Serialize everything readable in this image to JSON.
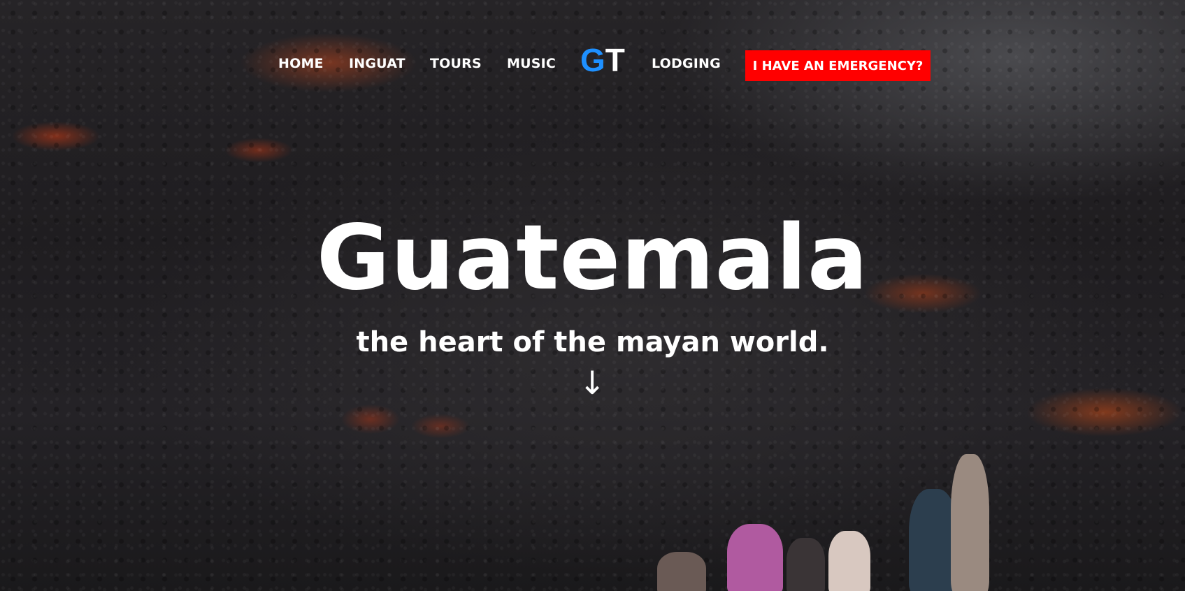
{
  "nav": {
    "items": [
      {
        "label": "HOME"
      },
      {
        "label": "INGUAT"
      },
      {
        "label": "TOURS"
      },
      {
        "label": "MUSIC"
      },
      {
        "label": "LODGING"
      }
    ],
    "logo": {
      "g": "G",
      "t": "T"
    },
    "emergency_label": "I HAVE AN EMERGENCY?"
  },
  "hero": {
    "title": "Guatemala",
    "subtitle": "the heart of the mayan world.",
    "arrow_icon": "arrow-down-icon",
    "arrow_glyph": "↓"
  },
  "colors": {
    "logo_g": "#1e90ff",
    "logo_t": "#ffffff",
    "emergency_bg": "#ff0000",
    "text": "#ffffff"
  }
}
